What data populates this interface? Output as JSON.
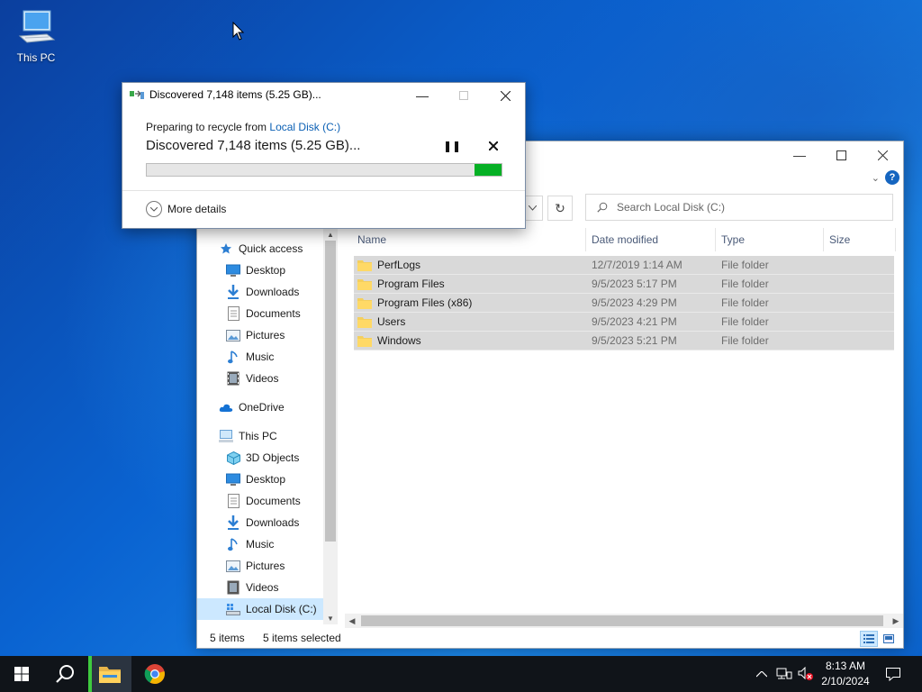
{
  "desktop": {
    "icons": [
      {
        "label": "This PC",
        "icon": "computer-icon"
      }
    ]
  },
  "explorer": {
    "search": {
      "placeholder": "Search Local Disk (C:)"
    },
    "nav": {
      "quick_access": "Quick access",
      "quick_items": [
        {
          "label": "Desktop",
          "icon": "desktop-icon",
          "pinned": true
        },
        {
          "label": "Downloads",
          "icon": "downloads-icon",
          "pinned": true
        },
        {
          "label": "Documents",
          "icon": "documents-icon",
          "pinned": true
        },
        {
          "label": "Pictures",
          "icon": "pictures-icon",
          "pinned": true
        },
        {
          "label": "Music",
          "icon": "music-icon",
          "pinned": false
        },
        {
          "label": "Videos",
          "icon": "videos-icon",
          "pinned": false
        }
      ],
      "onedrive": "OneDrive",
      "this_pc": "This PC",
      "pc_items": [
        {
          "label": "3D Objects",
          "icon": "3d-objects-icon"
        },
        {
          "label": "Desktop",
          "icon": "desktop-icon"
        },
        {
          "label": "Documents",
          "icon": "documents-icon"
        },
        {
          "label": "Downloads",
          "icon": "downloads-icon"
        },
        {
          "label": "Music",
          "icon": "music-icon"
        },
        {
          "label": "Pictures",
          "icon": "pictures-icon"
        },
        {
          "label": "Videos",
          "icon": "videos-icon"
        }
      ],
      "local_disk": "Local Disk (C:)"
    },
    "columns": {
      "name": "Name",
      "date": "Date modified",
      "type": "Type",
      "size": "Size"
    },
    "files": [
      {
        "name": "PerfLogs",
        "date": "12/7/2019 1:14 AM",
        "type": "File folder"
      },
      {
        "name": "Program Files",
        "date": "9/5/2023 5:17 PM",
        "type": "File folder"
      },
      {
        "name": "Program Files (x86)",
        "date": "9/5/2023 4:29 PM",
        "type": "File folder"
      },
      {
        "name": "Users",
        "date": "9/5/2023 4:21 PM",
        "type": "File folder"
      },
      {
        "name": "Windows",
        "date": "9/5/2023 5:21 PM",
        "type": "File folder"
      }
    ],
    "status": {
      "count": "5 items",
      "selected": "5 items selected"
    }
  },
  "dialog": {
    "title": "Discovered 7,148 items (5.25 GB)...",
    "sub_prefix": "Preparing to recycle from ",
    "sub_link": "Local Disk (C:)",
    "main": "Discovered 7,148 items (5.25 GB)...",
    "progress_fraction": 0.075,
    "more_details": "More details"
  },
  "taskbar": {
    "time": "8:13 AM",
    "date": "2/10/2024"
  },
  "colors": {
    "progress_green": "#06b025",
    "selection_gray": "#d9d9d9",
    "nav_selected": "#cce8ff",
    "link_blue": "#0a5fb4"
  }
}
